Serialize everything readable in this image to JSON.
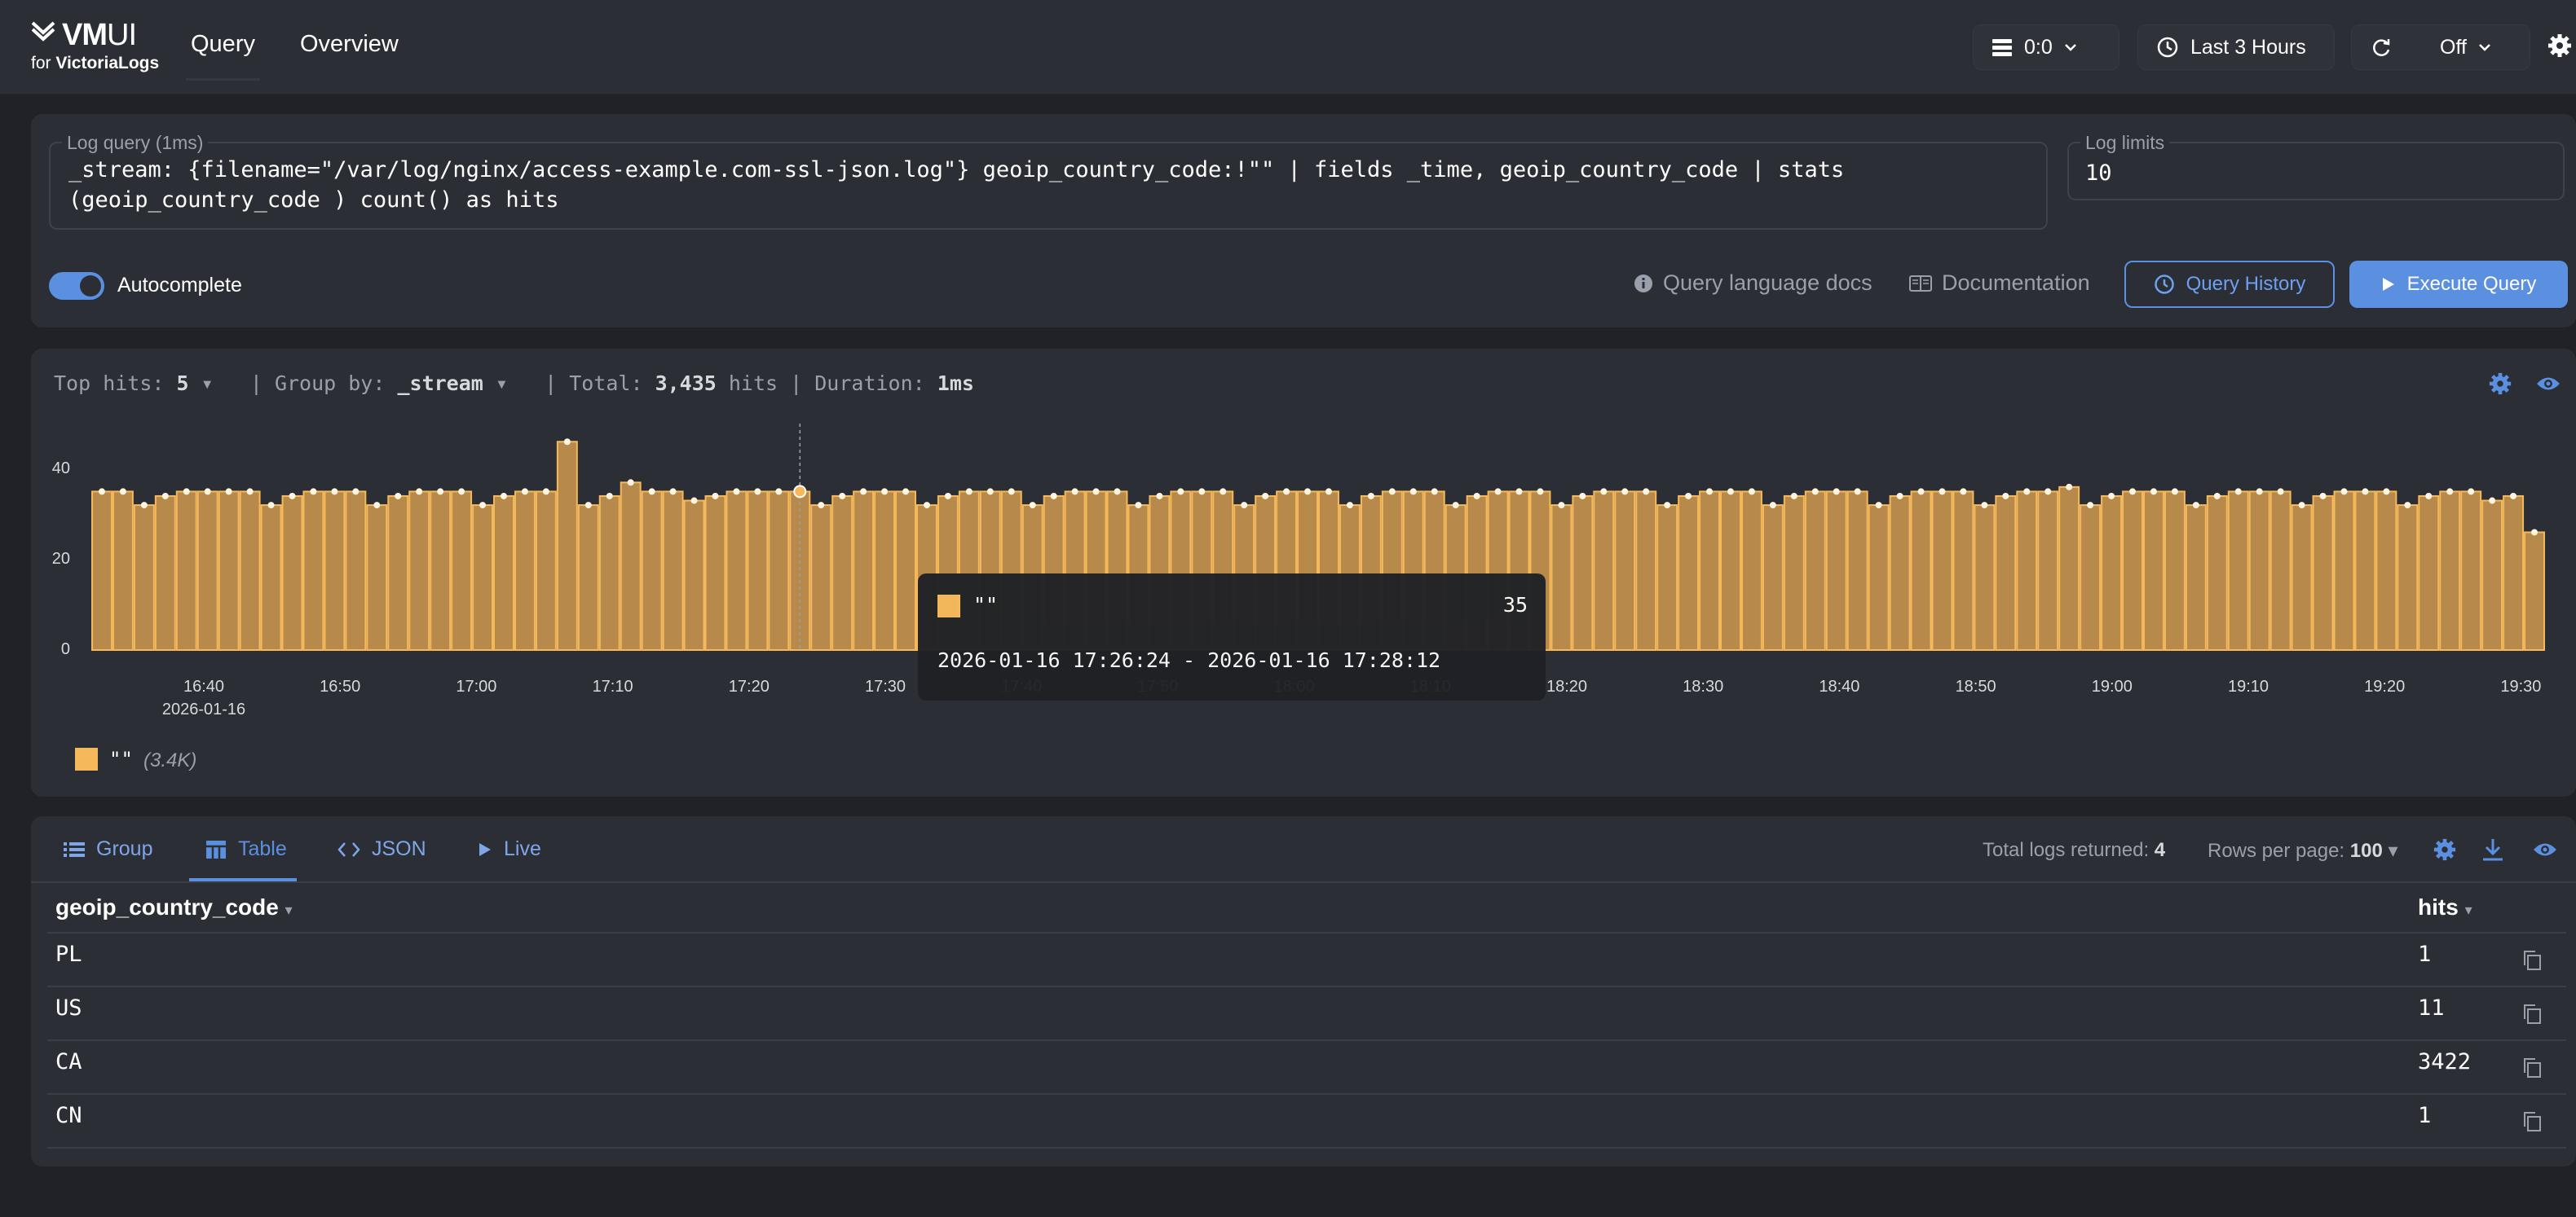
{
  "header": {
    "logo_text_bold": "VM",
    "logo_text_light": "UI",
    "logo_sub_prefix": "for ",
    "logo_sub_brand": "VictoriaLogs",
    "tabs": [
      {
        "label": "Query"
      },
      {
        "label": "Overview"
      }
    ],
    "tenant": "0:0",
    "time_range": "Last 3 Hours",
    "refresh": "Off",
    "icons": [
      "tenant-list-icon",
      "clock-icon",
      "refresh-icon",
      "settings-icon"
    ]
  },
  "query": {
    "legend": "Log query (1ms)",
    "line1": "_stream: {filename=\"/var/log/nginx/access-example.com-ssl-json.log\"} geoip_country_code:!\"\" | fields _time, geoip_country_code | stats",
    "line2": "(geoip_country_code ) count() as hits",
    "limits_legend": "Log limits",
    "limits_value": "10",
    "autocomplete_label": "Autocomplete",
    "autocomplete_on": true,
    "docs_label": "Query language docs",
    "documentation_label": "Documentation",
    "history_label": "Query History",
    "execute_label": "Execute Query"
  },
  "summary": {
    "top_hits_label": "Top hits: ",
    "top_hits_value": "5",
    "group_by_label": "| Group by: ",
    "group_by_value": "_stream",
    "total_label": "| Total: ",
    "total_value": "3,435",
    "hits_suffix": " hits | Duration: ",
    "duration_value": "1ms"
  },
  "chart_data": {
    "type": "bar",
    "y_ticks": [
      "0",
      "20",
      "40"
    ],
    "ylim": [
      0,
      50
    ],
    "x_ticks": [
      "16:40",
      "16:50",
      "17:00",
      "17:10",
      "17:20",
      "17:30",
      "17:40",
      "17:50",
      "18:00",
      "18:10",
      "18:20",
      "18:30",
      "18:40",
      "18:50",
      "19:00",
      "19:10",
      "19:20",
      "19:30"
    ],
    "x_date": "2026-01-16",
    "series": [
      {
        "name": "\"\"",
        "color": "#f5b95b",
        "values": [
          35,
          35,
          32,
          34,
          35,
          35,
          35,
          35,
          32,
          34,
          35,
          35,
          35,
          32,
          34,
          35,
          35,
          35,
          32,
          34,
          35,
          35,
          46,
          32,
          34,
          37,
          35,
          35,
          33,
          34,
          35,
          35,
          35,
          35,
          32,
          34,
          35,
          35,
          35,
          32,
          34,
          35,
          35,
          35,
          32,
          34,
          35,
          35,
          35,
          32,
          34,
          35,
          35,
          35,
          32,
          34,
          35,
          35,
          35,
          32,
          34,
          35,
          35,
          35,
          32,
          34,
          35,
          35,
          35,
          32,
          34,
          35,
          35,
          35,
          32,
          34,
          35,
          35,
          35,
          32,
          34,
          35,
          35,
          35,
          32,
          34,
          35,
          35,
          35,
          32,
          34,
          35,
          35,
          36,
          32,
          34,
          35,
          35,
          35,
          32,
          34,
          35,
          35,
          35,
          32,
          34,
          35,
          35,
          35,
          32,
          34,
          35,
          35,
          33,
          34,
          26
        ]
      }
    ],
    "legend": [
      {
        "label": "\"\"",
        "count": "(3.4K)",
        "color": "#f5b95b"
      }
    ],
    "tooltip": {
      "series": "\"\"",
      "value": "35",
      "range": "2026-01-16 17:26:24 - 2026-01-16 17:28:12"
    }
  },
  "table": {
    "tabs": [
      {
        "label": "Group"
      },
      {
        "label": "Table"
      },
      {
        "label": "JSON"
      },
      {
        "label": "Live"
      }
    ],
    "total_label": "Total logs returned: ",
    "total_value": "4",
    "rows_label": "Rows per page: ",
    "rows_value": "100",
    "columns": [
      "geoip_country_code",
      "hits"
    ],
    "rows": [
      {
        "code": "PL",
        "hits": "1"
      },
      {
        "code": "US",
        "hits": "11"
      },
      {
        "code": "CA",
        "hits": "3422"
      },
      {
        "code": "CN",
        "hits": "1"
      }
    ]
  }
}
